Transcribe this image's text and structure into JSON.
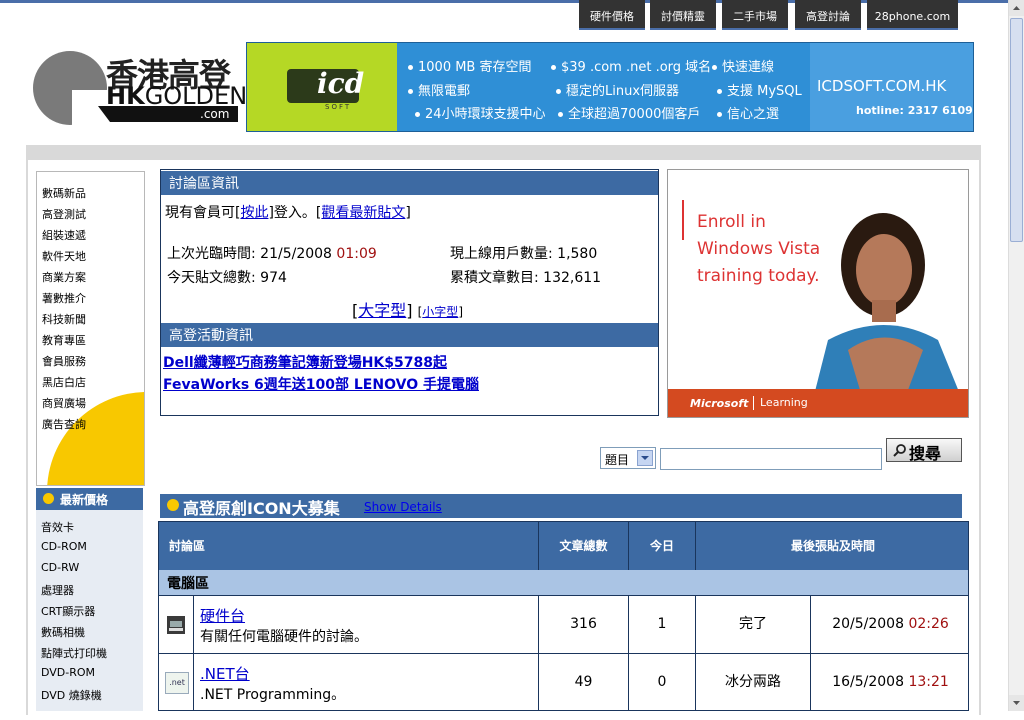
{
  "topnav": [
    "硬件價格",
    "討價精靈",
    "二手市場",
    "高登討論",
    "28phone.com"
  ],
  "logo": {
    "cn": "香港高登",
    "en_hk": "HK",
    "en_golden": "GOLDEN",
    "dotcom": ".com"
  },
  "banner": {
    "brand": "icd",
    "brand_sub": "SOFT",
    "col1": [
      "1000 MB 寄存空間",
      "無限電郵",
      "24小時環球支援中心"
    ],
    "col2": [
      "$39 .com .net .org 域名",
      "穩定的Linux伺服器",
      "全球超過70000個客戶"
    ],
    "col3": [
      "快速連線",
      "支援 MySQL",
      "信心之選"
    ],
    "site": "ICDSOFT.COM.HK",
    "hotline": "hotline: 2317 6109"
  },
  "sidebar": {
    "items": [
      "數碼新品",
      "高登測試",
      "組裝速遞",
      "軟件天地",
      "商業方案",
      "薯數推介",
      "科技新聞",
      "教育專區",
      "會員服務",
      "黑店白店",
      "商貿廣場",
      "廣告查詢"
    ],
    "price_title": "最新價格",
    "price_items": [
      "音效卡",
      "CD-ROM",
      "CD-RW",
      "處理器",
      "CRT顯示器",
      "數碼相機",
      "點陣式打印機",
      "DVD-ROM",
      "DVD 燒錄機"
    ]
  },
  "info": {
    "title": "討論區資訊",
    "login_prefix": "現有會員可[",
    "login_link": "按此",
    "login_mid": "]登入。[",
    "latest_link": "觀看最新貼文",
    "login_suffix": "]",
    "last_visit_label": "上次光臨時間: 21/5/2008 ",
    "last_visit_time": "01:09",
    "online_label": "現上線用戶數量: 1,580",
    "today_posts": "今天貼文總數: 974",
    "total_articles": "累積文章數目: 132,611",
    "big_font": "大字型",
    "small_font": "小字型",
    "bracket_open": "[",
    "bracket_close": "]",
    "activity_title": "高登活動資訊",
    "news1": "Dell纖薄輕巧商務筆記簿新登場HK$5788起",
    "news2": "FevaWorks 6週年送100部 LENOVO 手提電腦"
  },
  "ad": {
    "line1": "Enroll in",
    "line2": "Windows Vista",
    "line3": "training today.",
    "ms": "Microsoft",
    "learning": "Learning"
  },
  "search": {
    "option": "題目",
    "button": "搜尋"
  },
  "contest": {
    "title": "高登原創ICON大募集",
    "link": "Show Details"
  },
  "table": {
    "headers": [
      "討論區",
      "文章總數",
      "今日",
      "最後張貼及時間"
    ],
    "section": "電腦區",
    "rows": [
      {
        "name": "硬件台",
        "desc": "有關任何電腦硬件的討論。",
        "count": "316",
        "today": "1",
        "last_user": "完了",
        "last_date": "20/5/2008 ",
        "last_time": "02:26"
      },
      {
        "name": ".NET台",
        "desc": ".NET Programming。",
        "count": "49",
        "today": "0",
        "last_user": "冰分兩路",
        "last_date": "16/5/2008 ",
        "last_time": "13:21"
      }
    ]
  }
}
